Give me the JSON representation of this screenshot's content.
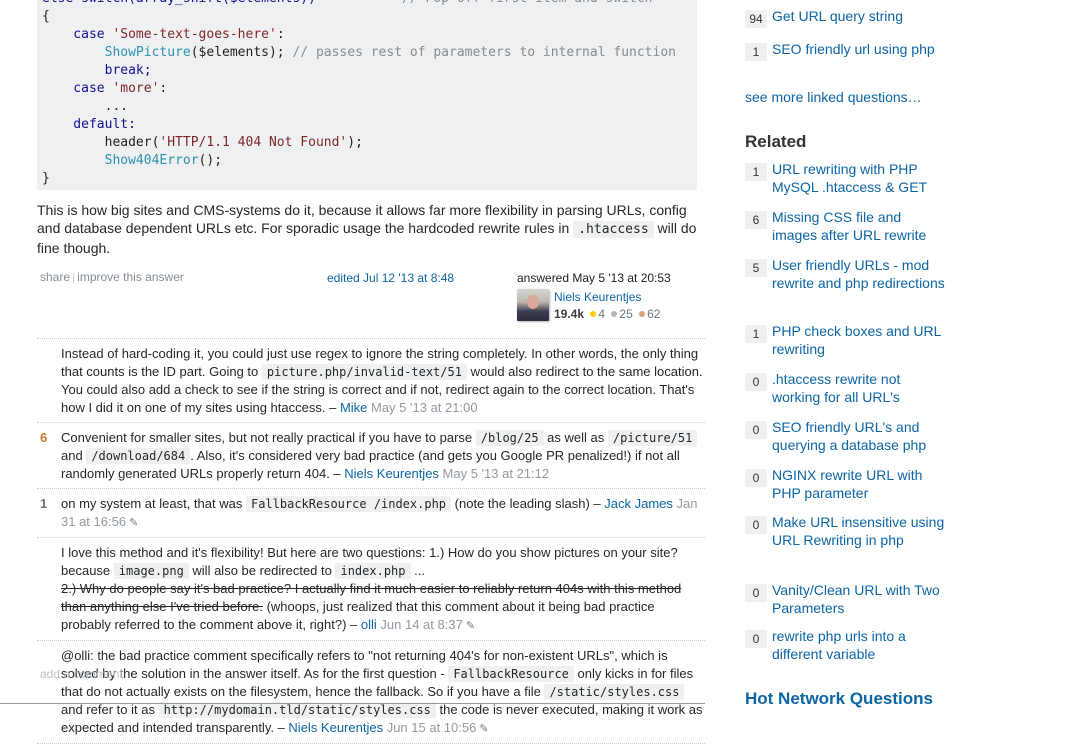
{
  "code": {
    "lines": [
      [
        {
          "t": "else switch(array_shift($elements))",
          "c": "kw"
        },
        {
          "t": "           // Pop off first item and switch",
          "c": "cm"
        }
      ],
      [
        {
          "t": "{",
          "c": ""
        }
      ],
      [
        {
          "t": "    case ",
          "c": "kw"
        },
        {
          "t": "'Some-text-goes-here'",
          "c": "str"
        },
        {
          "t": ":",
          "c": ""
        }
      ],
      [
        {
          "t": "        ",
          "c": ""
        },
        {
          "t": "ShowPicture",
          "c": "fn"
        },
        {
          "t": "($elements); ",
          "c": ""
        },
        {
          "t": "// passes rest of parameters to internal function",
          "c": "cm"
        }
      ],
      [
        {
          "t": "        break;",
          "c": "kw"
        }
      ],
      [
        {
          "t": "    case ",
          "c": "kw"
        },
        {
          "t": "'more'",
          "c": "str"
        },
        {
          "t": ":",
          "c": ""
        }
      ],
      [
        {
          "t": "        ...",
          "c": ""
        }
      ],
      [
        {
          "t": "    default:",
          "c": "kw"
        }
      ],
      [
        {
          "t": "        header(",
          "c": ""
        },
        {
          "t": "'HTTP/1.1 404 Not Found'",
          "c": "str"
        },
        {
          "t": ");",
          "c": ""
        }
      ],
      [
        {
          "t": "        ",
          "c": ""
        },
        {
          "t": "Show404Error",
          "c": "fn"
        },
        {
          "t": "();",
          "c": ""
        }
      ],
      [
        {
          "t": "}",
          "c": ""
        }
      ]
    ]
  },
  "answer": {
    "text_before": "This is how big sites and CMS-systems do it, because it allows far more flexibility in parsing URLs, config and database dependent URLs etc. For sporadic usage the hardcoded rewrite rules in ",
    "code": ".htaccess",
    "text_after": " will do fine though.",
    "share_label": "share",
    "improve_label": "improve this answer",
    "edited_label": "edited Jul 12 '13 at 8:48",
    "answered_label": "answered May 5 '13 at 20:53",
    "user": {
      "name": "Niels Keurentjes",
      "reputation": "19.4k",
      "gold": "4",
      "silver": "25",
      "bronze": "62",
      "gold_color": "#ffcc01",
      "silver_color": "#b4b8bc",
      "bronze_color": "#d1a684"
    }
  },
  "comments": [
    {
      "score": "",
      "parts": [
        {
          "t": "Instead of hard-coding it, you could just use regex to ignore the string completely. In other words, the only thing that counts is the ID part. Going to "
        },
        {
          "code": "picture.php/invalid-text/51"
        },
        {
          "t": " would also redirect to the same location. You could also add a check to see if the string is correct and if not, redirect again to the correct location. That's how I did it on one of my sites using htaccess. – "
        }
      ],
      "author": "Mike",
      "time": "May 5 '13 at 21:00",
      "edited": false
    },
    {
      "score": "6",
      "parts": [
        {
          "t": "Convenient for smaller sites, but not really practical if you have to parse "
        },
        {
          "code": "/blog/25"
        },
        {
          "t": " as well as "
        },
        {
          "code": "/picture/51"
        },
        {
          "t": " and "
        },
        {
          "code": "/download/684"
        },
        {
          "t": ". Also, it's considered very bad practice (and gets you Google PR penalized!) if not all randomly generated URLs properly return 404. – "
        }
      ],
      "author": "Niels Keurentjes",
      "time": "May 5 '13 at 21:12",
      "edited": false
    },
    {
      "score": "1",
      "parts": [
        {
          "t": "on my system at least, that was "
        },
        {
          "code": "FallbackResource /index.php"
        },
        {
          "t": " (note the leading slash) – "
        }
      ],
      "author": "Jack James",
      "time": "Jan 31 at 16:56",
      "edited": true
    },
    {
      "score": "",
      "parts": [
        {
          "t": "I love this method and it's flexibility! But here are two questions: 1.) How do you show pictures on your site? because "
        },
        {
          "code": "image.png"
        },
        {
          "t": " will also be redirected to "
        },
        {
          "code": "index.php"
        },
        {
          "t": " ..."
        },
        {
          "br": true
        },
        {
          "strike": "2.) Why do people say it's bad practice? I actually find it much easier to reliably return 404s with this method than anything else I've tried before."
        },
        {
          "t": " (whoops, just realized that this comment about it being bad practice probably referred to the comment above it, right?) – "
        }
      ],
      "author": "olli",
      "time": "Jun 14 at 8:37",
      "edited": true
    },
    {
      "score": "",
      "parts": [
        {
          "t": "@olli: the bad practice comment specifically refers to \"not returning 404's for non-existent URLs\", which is solved by the solution in the answer itself. As for the first question - "
        },
        {
          "code": "FallbackResource"
        },
        {
          "t": " only kicks in for files that do not actually exists on the filesystem, hence the fallback. So if you have a file "
        },
        {
          "code": "/static/styles.css"
        },
        {
          "t": " and refer to it as "
        },
        {
          "code": "http://mydomain.tld/static/styles.css"
        },
        {
          "t": " the code is never executed, making it work as expected and intended transparently. – "
        }
      ],
      "author": "Niels Keurentjes",
      "time": "Jun 15 at 10:56",
      "edited": true
    }
  ],
  "add_comment_label": "add a comment",
  "sidebar": {
    "linked": [
      {
        "count": "94",
        "title": "Get URL query string"
      },
      {
        "count": "1",
        "title": "SEO friendly url using php"
      }
    ],
    "see_more_label": "see more linked questions…",
    "related_heading": "Related",
    "related": [
      {
        "count": "1",
        "title": "URL rewriting with PHP MySQL .htaccess & GET"
      },
      {
        "count": "6",
        "title": "Missing CSS file and images after URL rewrite"
      },
      {
        "count": "5",
        "title": "User friendly URLs - mod rewrite and php redirections"
      },
      {
        "count": "1",
        "title": "PHP check boxes and URL rewriting"
      },
      {
        "count": "0",
        "title": ".htaccess rewrite not working for all URL's"
      },
      {
        "count": "0",
        "title": "SEO friendly URL's and querying a database php"
      },
      {
        "count": "0",
        "title": "NGINX rewrite URL with PHP parameter"
      },
      {
        "count": "0",
        "title": "Make URL insensitive using URL Rewriting in php"
      },
      {
        "count": "0",
        "title": "Vanity/Clean URL with Two Parameters"
      },
      {
        "count": "0",
        "title": "rewrite php urls into a different variable"
      }
    ],
    "hot_network_label": "Hot Network Questions"
  }
}
